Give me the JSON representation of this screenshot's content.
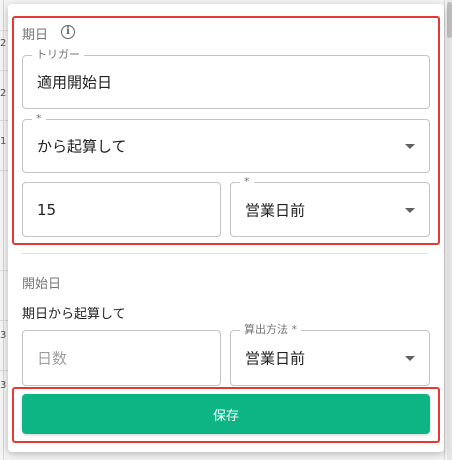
{
  "trigger_section": {
    "title": "期日",
    "info_icon": "info-icon",
    "trigger_field": {
      "label": "トリガー",
      "value": "適用開始日"
    },
    "calc_field": {
      "label": "*",
      "value": "から起算して"
    },
    "days_field": {
      "value": "15"
    },
    "day_type_field": {
      "label": "*",
      "value": "営業日前"
    }
  },
  "start_section": {
    "title": "開始日",
    "description": "期日から起算して",
    "days_field": {
      "placeholder": "日数"
    },
    "method_field": {
      "label": "算出方法 *",
      "value": "営業日前"
    }
  },
  "save_button": {
    "label": "保存"
  },
  "background": {
    "frag_1": "2",
    "frag_2": "2",
    "frag_3": "1",
    "frag_4": "3",
    "frag_5": "3"
  },
  "colors": {
    "accent": "#0db585",
    "highlight": "#e53935"
  }
}
